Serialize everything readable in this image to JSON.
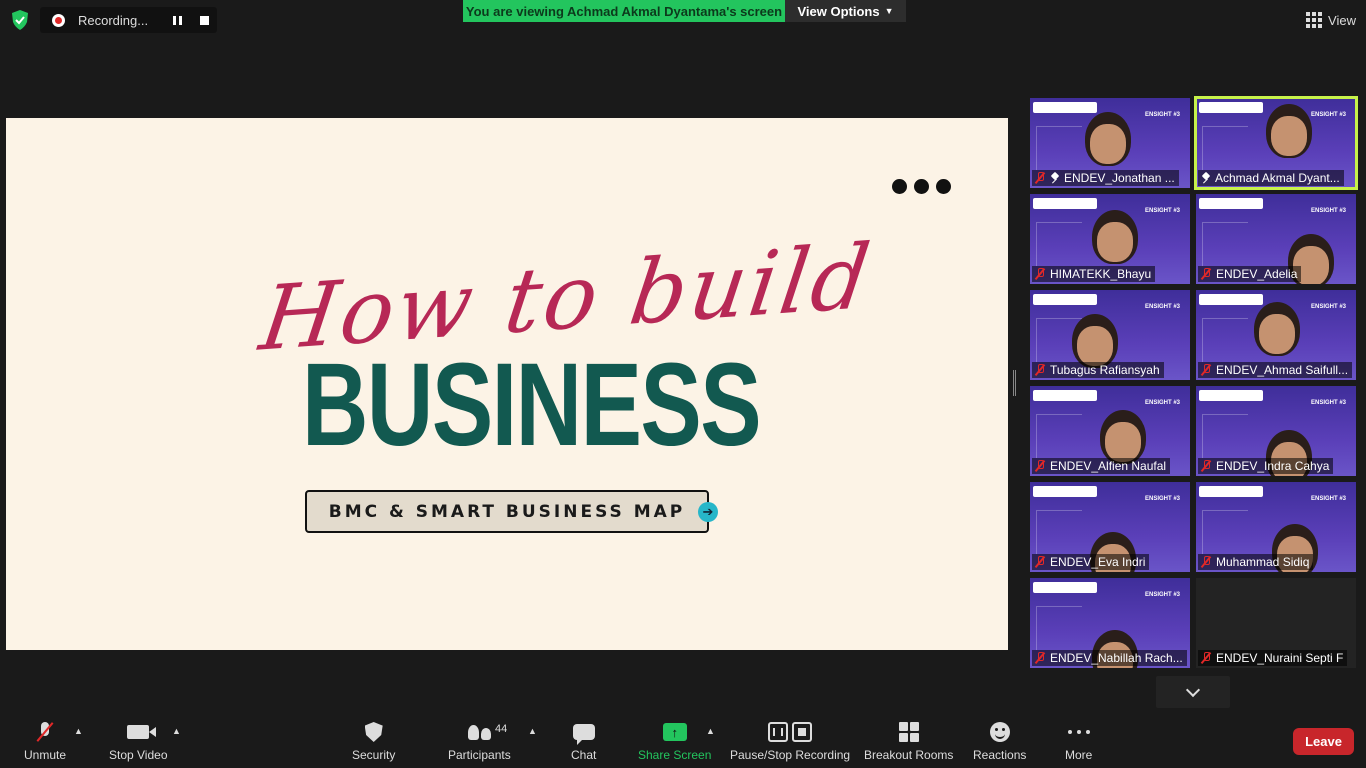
{
  "top_bar": {
    "recording_label": "Recording...",
    "viewing_banner": "You are viewing Achmad Akmal Dyantama's screen",
    "view_options": "View Options",
    "view_button": "View"
  },
  "slide": {
    "script_title": "How to build",
    "main_title": "BUSINESS",
    "subtitle": "BMC & SMART BUSINESS MAP"
  },
  "participants": [
    {
      "name": "ENDEV_Jonathan ...",
      "muted": true,
      "pinned": true
    },
    {
      "name": "Achmad Akmal Dyant...",
      "muted": false,
      "pinned": true,
      "active_speaker": true
    },
    {
      "name": "HIMATEKK_Bhayu",
      "muted": true
    },
    {
      "name": "ENDEV_Adelia",
      "muted": true
    },
    {
      "name": "Tubagus Rafiansyah",
      "muted": true
    },
    {
      "name": "ENDEV_Ahmad Saifull...",
      "muted": true
    },
    {
      "name": "ENDEV_Alfien Naufal",
      "muted": true
    },
    {
      "name": "ENDEV_Indra Cahya",
      "muted": true
    },
    {
      "name": "ENDEV_Eva Indri",
      "muted": true
    },
    {
      "name": "Muhammad Sidiq",
      "muted": true
    },
    {
      "name": "ENDEV_Nabillah Rach...",
      "muted": true
    },
    {
      "name": "ENDEV_Nuraini Septi F",
      "muted": true,
      "video_off": true
    }
  ],
  "tile_text": {
    "ensight": "ENSIGHT #3"
  },
  "toolbar": {
    "unmute": "Unmute",
    "stop_video": "Stop Video",
    "security": "Security",
    "participants": "Participants",
    "participants_count": "44",
    "chat": "Chat",
    "share_screen": "Share Screen",
    "pause_stop_recording": "Pause/Stop Recording",
    "breakout_rooms": "Breakout Rooms",
    "reactions": "Reactions",
    "more": "More",
    "leave": "Leave"
  },
  "colors": {
    "banner_green": "#23c55e",
    "active_speaker_outline": "#c7f24a",
    "leave_red": "#c8262b",
    "slide_bg": "#fcf3e6",
    "slide_script": "#b72856",
    "slide_title": "#125950"
  }
}
